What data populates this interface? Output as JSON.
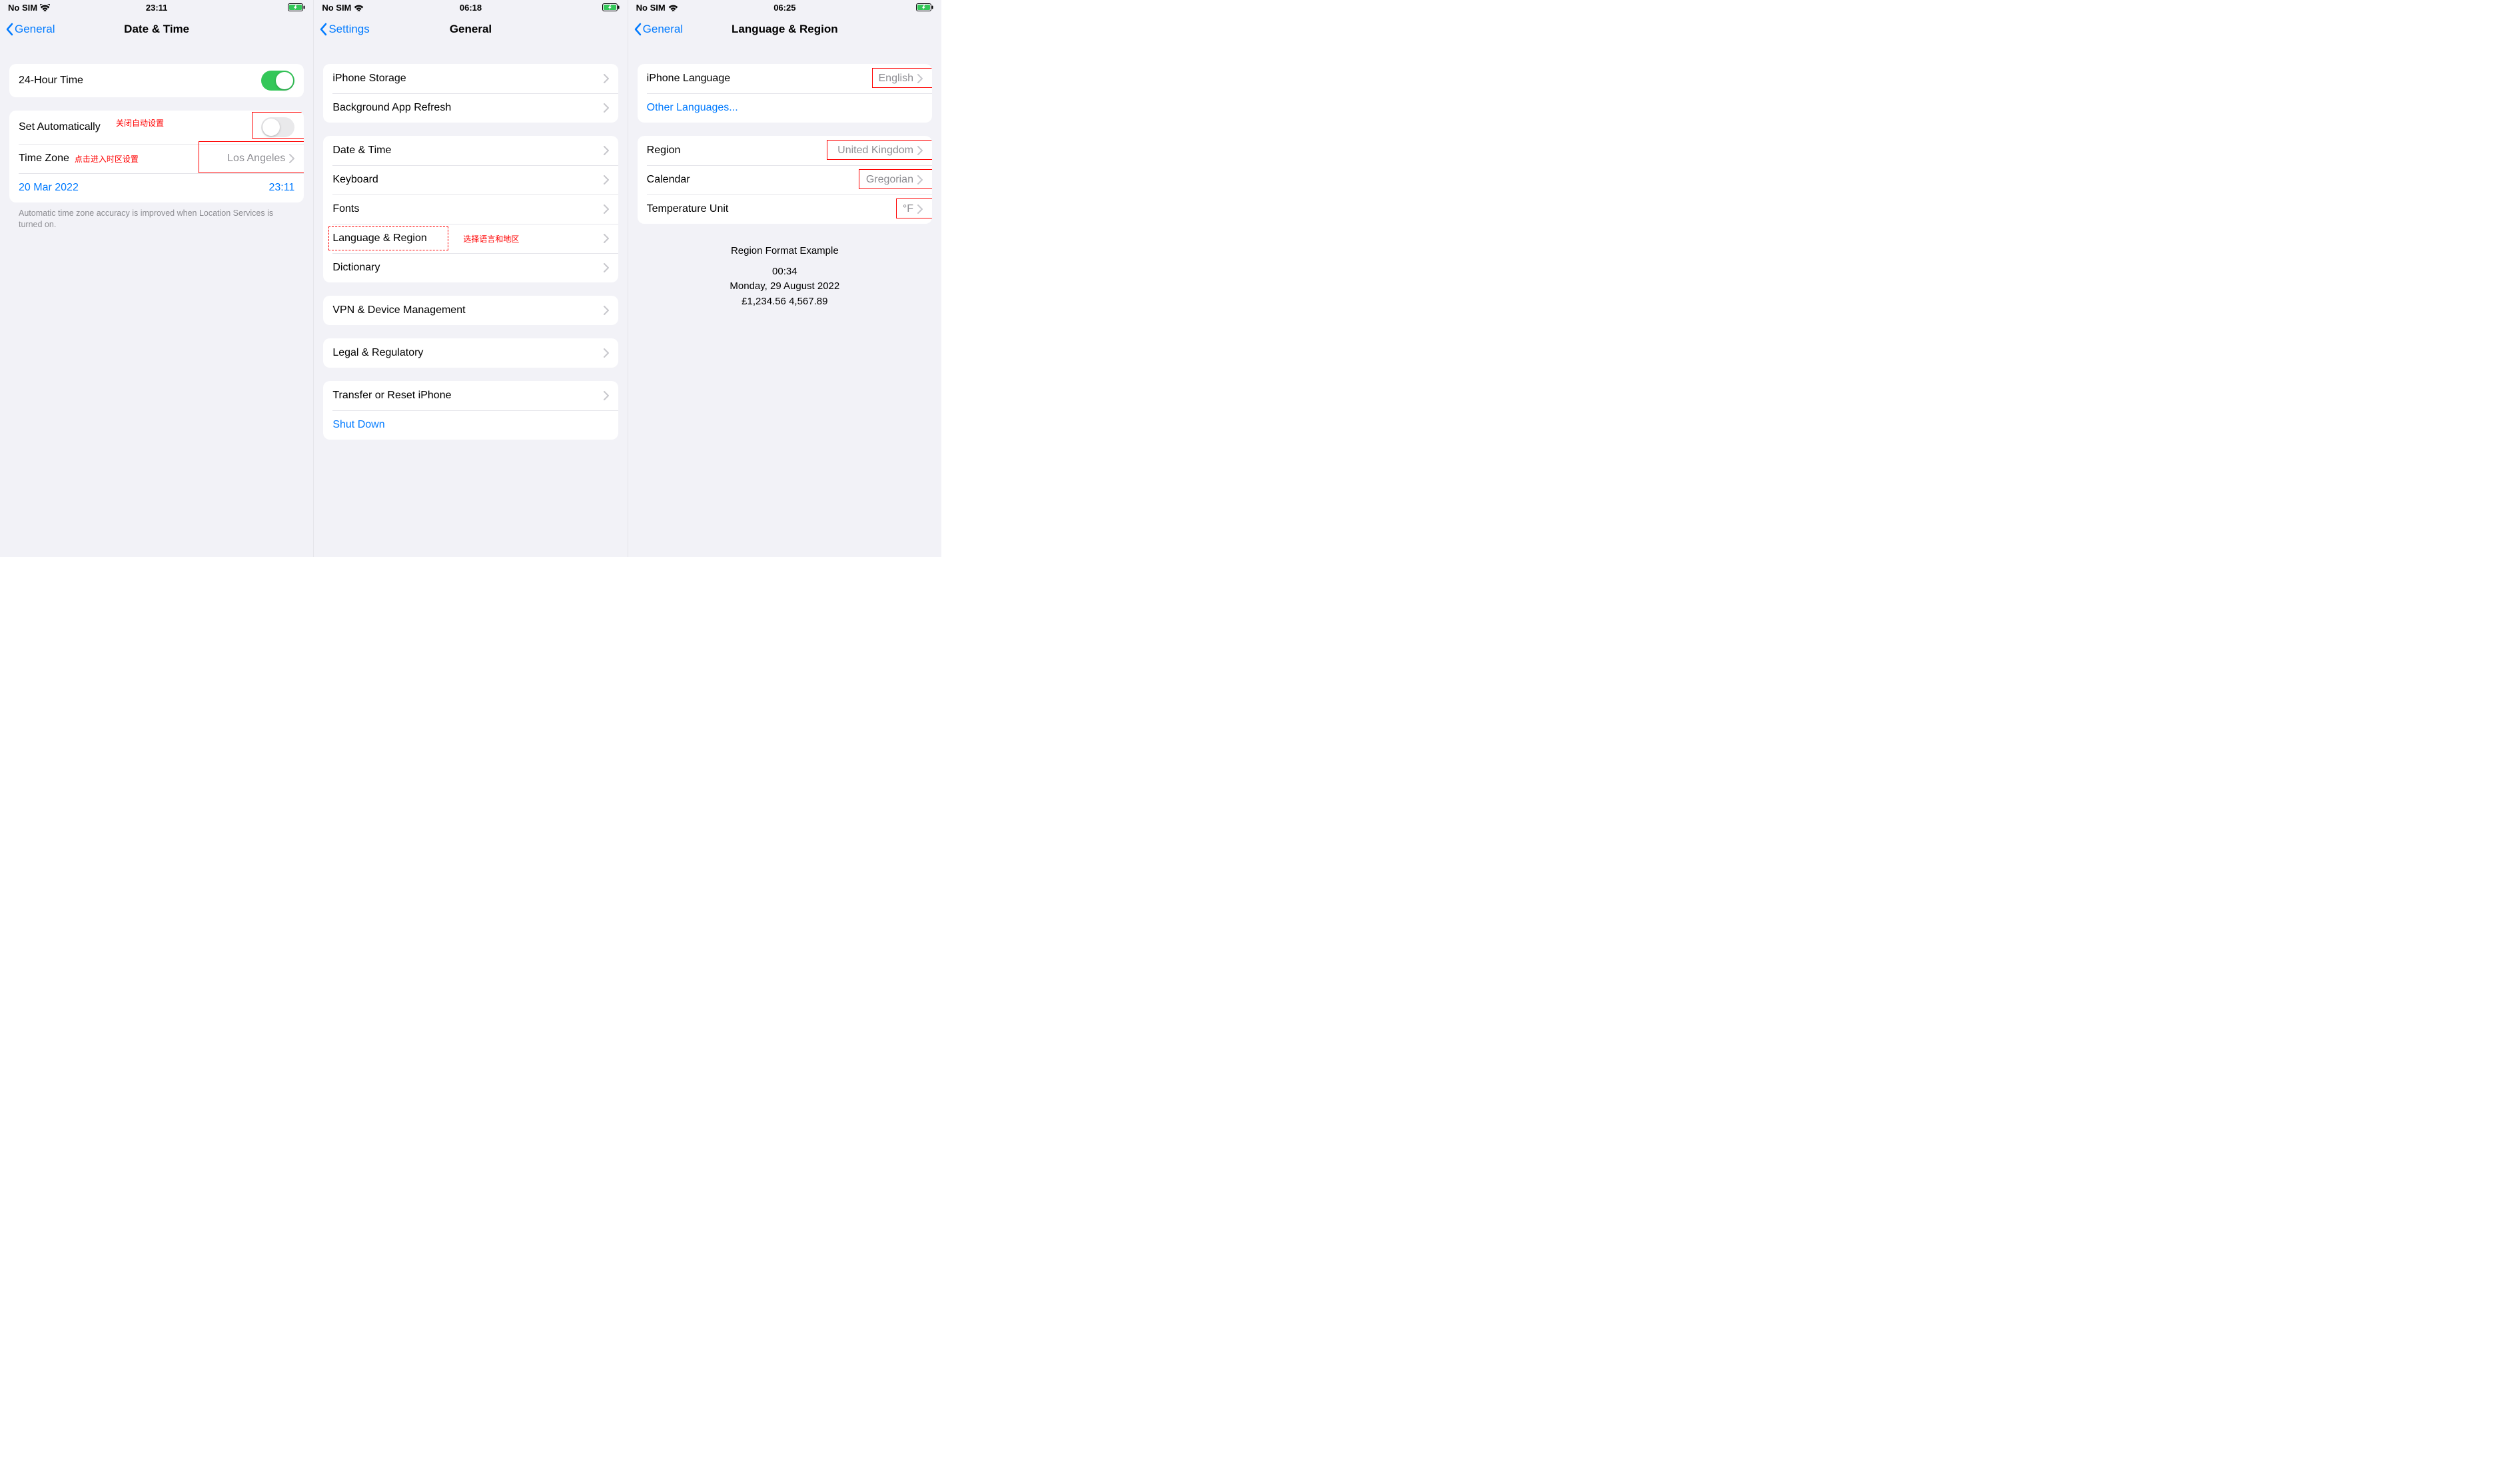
{
  "screens": [
    {
      "status": {
        "carrier": "No SIM",
        "time": "23:11"
      },
      "nav": {
        "back": "General",
        "title": "Date & Time"
      },
      "row_24h": "24-Hour Time",
      "row_auto": "Set Automatically",
      "anno_auto": "关闭自动设置",
      "row_tz": "Time Zone",
      "anno_tz": "点击进入时区设置",
      "tz_value": "Los Angeles",
      "date_value": "20 Mar 2022",
      "time_value": "23:11",
      "footer": "Automatic time zone accuracy is improved when Location Services is turned on."
    },
    {
      "status": {
        "carrier": "No SIM",
        "time": "06:18"
      },
      "nav": {
        "back": "Settings",
        "title": "General"
      },
      "rows1": [
        "iPhone Storage",
        "Background App Refresh"
      ],
      "rows2": [
        "Date & Time",
        "Keyboard",
        "Fonts",
        "Language & Region",
        "Dictionary"
      ],
      "anno_lang": "选择语言和地区",
      "rows3": [
        "VPN & Device Management"
      ],
      "rows4": [
        "Legal & Regulatory"
      ],
      "rows5_a": "Transfer or Reset iPhone",
      "rows5_b": "Shut Down"
    },
    {
      "status": {
        "carrier": "No SIM",
        "time": "06:25"
      },
      "nav": {
        "back": "General",
        "title": "Language & Region"
      },
      "row_lang": "iPhone Language",
      "row_lang_val": "English",
      "row_other": "Other Languages...",
      "row_region": "Region",
      "row_region_val": "United Kingdom",
      "row_cal": "Calendar",
      "row_cal_val": "Gregorian",
      "row_temp": "Temperature Unit",
      "row_temp_val": "°F",
      "example_hdr": "Region Format Example",
      "example_time": "00:34",
      "example_date": "Monday, 29 August 2022",
      "example_nums": "£1,234.56   4,567.89"
    }
  ]
}
